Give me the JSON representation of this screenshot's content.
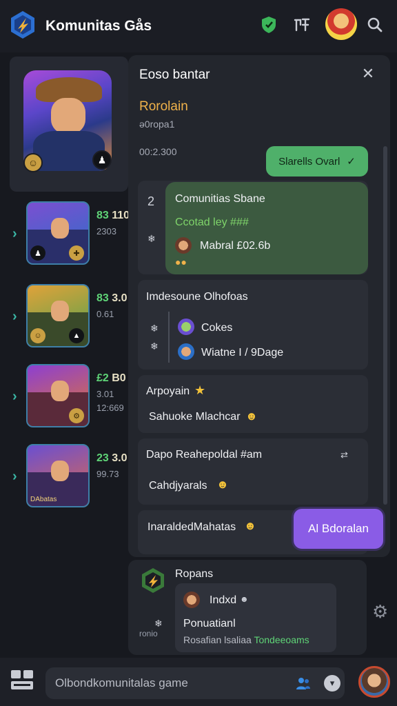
{
  "app": {
    "title": "Komunitas Gås"
  },
  "header": {
    "icons": [
      "shield-icon",
      "rank-icon",
      "avatar",
      "search-icon"
    ]
  },
  "profile": {
    "badge_left": "☺",
    "badge_right": "♟"
  },
  "list": [
    {
      "score_a": "83",
      "score_b": "110",
      "sub": "2303",
      "colors": [
        "#7b4fd1",
        "#2b6fc7"
      ]
    },
    {
      "score_a": "83",
      "score_b": "3.0",
      "sub": "0.61",
      "colors": [
        "#e0a23a",
        "#4fa14c"
      ]
    },
    {
      "score_a": "£2",
      "score_b": "B0",
      "sub": "3.01",
      "sub2": "12:669",
      "colors": [
        "#8d3fd1",
        "#e0782f"
      ]
    },
    {
      "score_a": "23",
      "score_b": "3.0",
      "sub": "99.73",
      "colors": [
        "#6a4fd1",
        "#e06a4a"
      ],
      "tag": "DAbatas"
    }
  ],
  "panel": {
    "title": "Eoso bantar",
    "role": "Rorolain",
    "meta1": "ǝ0ropa1",
    "meta2": "00:2.300",
    "green_button": "Slarells Ovarl",
    "green_check": "✓"
  },
  "cards": {
    "c1": {
      "title": "Comunitias Sbane",
      "subtitle": "Ccotad ley ###",
      "user": "Mabral £02.6b",
      "left_icons": [
        "2",
        "❄"
      ]
    },
    "c2": {
      "title": "Imdesoune Olhofoas",
      "rows": [
        "Cokes",
        "Wiatne I / 9Dage"
      ]
    },
    "c3": {
      "title": "Arpoyain",
      "body": "Sahuoke Mlachcar"
    },
    "c4": {
      "title": "Dapo Reahepoldal #am",
      "body": "Cahdjyarals"
    },
    "c5": {
      "title": "InaraldedMahatas"
    }
  },
  "purple_button": "Al Bdoralan",
  "bottom_card": {
    "title": "Ropans",
    "side_label": "ronio",
    "user": "Indxd",
    "line1": "Ponuatianl",
    "line2_a": "Rosafian lsaliaa",
    "line2_b": "Tondeeoams"
  },
  "composer": {
    "placeholder": "Olbondkomunitalas game"
  }
}
